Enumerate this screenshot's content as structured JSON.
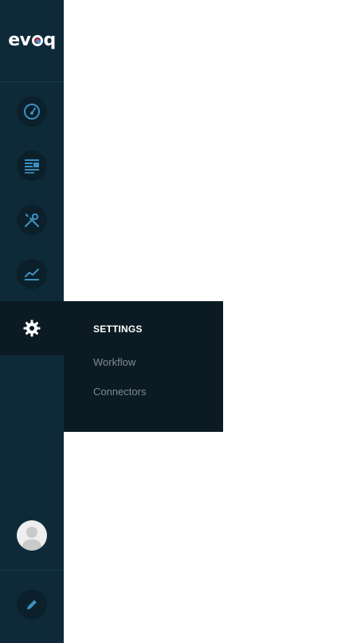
{
  "app": {
    "logo_text_pre": "ev",
    "logo_text_post": "q"
  },
  "sidebar": {
    "items": [
      {
        "icon": "dashboard-icon"
      },
      {
        "icon": "content-icon"
      },
      {
        "icon": "tools-icon"
      },
      {
        "icon": "analytics-icon"
      },
      {
        "icon": "gear-icon",
        "active": true
      }
    ],
    "bottom": [
      {
        "icon": "avatar"
      },
      {
        "icon": "pencil-icon"
      }
    ]
  },
  "flyout": {
    "title": "SETTINGS",
    "items": [
      {
        "label": "Workflow"
      },
      {
        "label": "Connectors"
      }
    ]
  },
  "colors": {
    "sidebar_bg": "#0e2a38",
    "active_bg": "#0b1a23",
    "icon_accent": "#3d8fbf",
    "flyout_text_muted": "#7f8b92"
  }
}
